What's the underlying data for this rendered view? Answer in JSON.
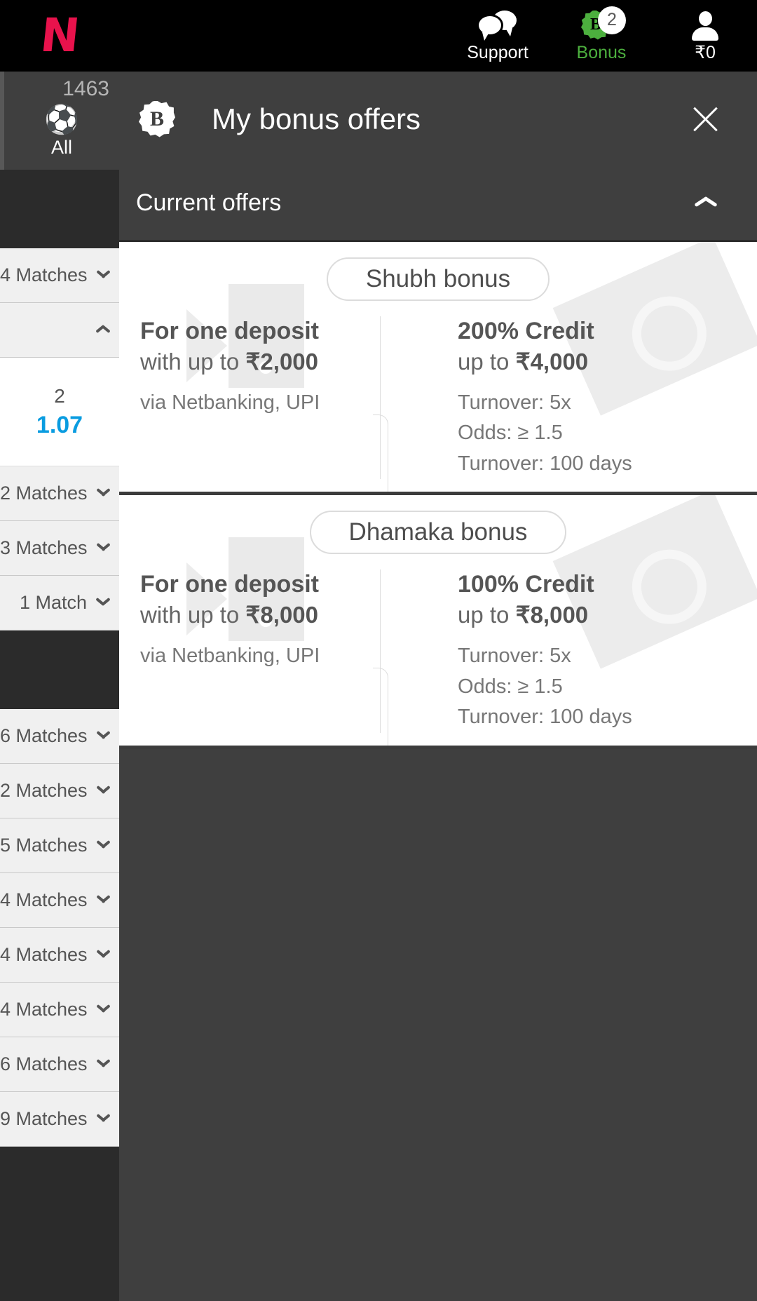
{
  "header": {
    "logo": "N",
    "items": [
      {
        "name": "support",
        "label": "Support",
        "icon": "chat-icon"
      },
      {
        "name": "bonus",
        "label": "Bonus",
        "icon": "bonus-badge-icon",
        "count": "2",
        "badge_letter": "B",
        "color": "#4caf3e"
      },
      {
        "name": "account",
        "label": "₹0",
        "icon": "user-icon"
      }
    ]
  },
  "sidebar": {
    "sport_tab": {
      "count": "1463",
      "label": "All",
      "icon": "all-sports-icon"
    },
    "rows": [
      {
        "label": "4 Matches",
        "state": "collapsed"
      },
      {
        "label": "",
        "state": "expanded"
      }
    ],
    "odds": {
      "selection": "2",
      "value": "1.07"
    },
    "rows2": [
      {
        "label": "2 Matches",
        "state": "collapsed"
      },
      {
        "label": "3 Matches",
        "state": "collapsed"
      },
      {
        "label": "1 Match",
        "state": "collapsed"
      }
    ],
    "rows3": [
      {
        "label": "6 Matches",
        "state": "collapsed"
      },
      {
        "label": "2 Matches",
        "state": "collapsed"
      },
      {
        "label": "5 Matches",
        "state": "collapsed"
      },
      {
        "label": "4 Matches",
        "state": "collapsed"
      },
      {
        "label": "4 Matches",
        "state": "collapsed"
      },
      {
        "label": "4 Matches",
        "state": "collapsed"
      },
      {
        "label": "6 Matches",
        "state": "collapsed"
      },
      {
        "label": "9 Matches",
        "state": "collapsed"
      }
    ]
  },
  "modal": {
    "icon": "bonus-badge-icon",
    "badge_letter": "B",
    "title": "My bonus offers",
    "close_label": "×",
    "section": {
      "title": "Current offers",
      "expanded": true
    },
    "offers": [
      {
        "name": "Shubh bonus",
        "left": {
          "heading": "For one deposit",
          "sub_prefix": "with up to ",
          "sub_amount": "₹2,000",
          "note": "via Netbanking, UPI"
        },
        "right": {
          "heading": "200% Credit",
          "sub_prefix": "up to ",
          "sub_amount": "₹4,000",
          "lines": [
            "Turnover: 5x",
            "Odds: ≥ 1.5",
            "Turnover: 100 days"
          ]
        }
      },
      {
        "name": "Dhamaka bonus",
        "left": {
          "heading": "For one deposit",
          "sub_prefix": "with up to ",
          "sub_amount": "₹8,000",
          "note": "via Netbanking, UPI"
        },
        "right": {
          "heading": "100% Credit",
          "sub_prefix": "up to ",
          "sub_amount": "₹8,000",
          "lines": [
            "Turnover: 5x",
            "Odds: ≥ 1.5",
            "Turnover: 100 days"
          ]
        }
      }
    ]
  },
  "colors": {
    "brand_red": "#e8124c",
    "bonus_green": "#4caf3e",
    "odds_blue": "#0a9ce0",
    "panel_bg": "#3f3f3f",
    "page_bg": "#2b2b2b"
  }
}
